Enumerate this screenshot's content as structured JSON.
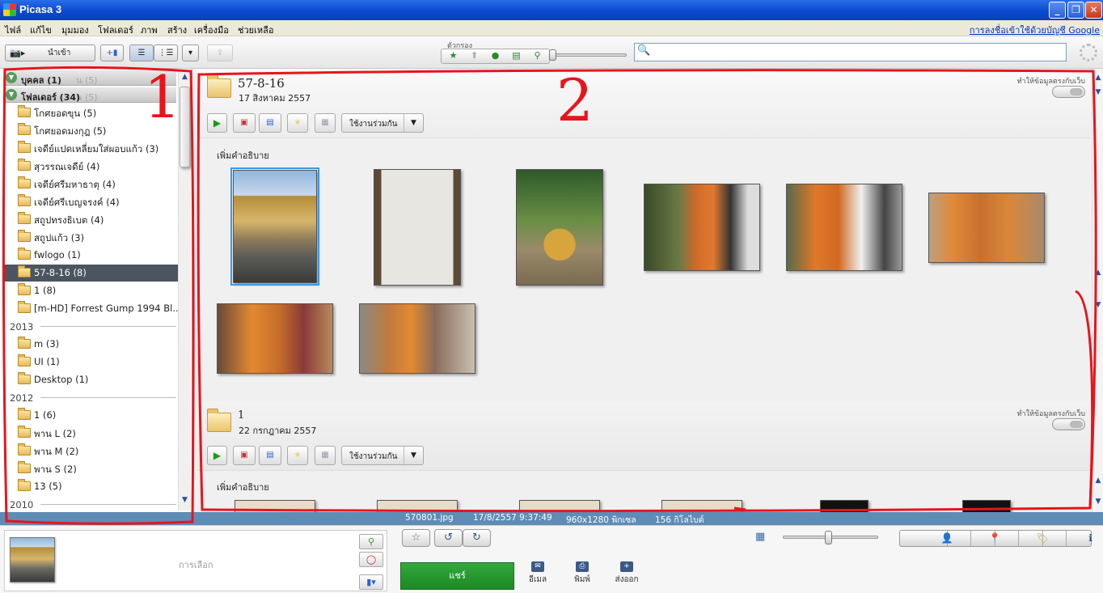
{
  "window": {
    "title": "Picasa 3"
  },
  "menu": {
    "items": [
      "ไฟล์",
      "แก้ไข",
      "มุมมอง",
      "โฟลเดอร์",
      "ภาพ",
      "สร้าง",
      "เครื่องมือ",
      "ช่วยเหลือ"
    ],
    "signin": "การลงชื่อเข้าใช้ด้วยบัญชี Google"
  },
  "toolbar": {
    "import_label": "นำเข้า",
    "filter_label": "ตัวกรอง",
    "search_placeholder": ""
  },
  "library": {
    "groups": [
      {
        "label": "บุคคล (1)",
        "ghost": "น (5)"
      },
      {
        "label": "โฟลเดอร์ (34)",
        "ghost": "น (5)"
      }
    ],
    "rows": [
      {
        "type": "folder",
        "label": "โกศยอดขุน (5)"
      },
      {
        "type": "folder",
        "label": "โกศยอดมงกุฎ (5)"
      },
      {
        "type": "folder",
        "label": "เจดีย์แปดเหลี่ยมใส่ผอบแก้ว (3)"
      },
      {
        "type": "folder",
        "label": "สุวรรณเจดีย์ (4)"
      },
      {
        "type": "folder",
        "label": "เจดีย์ศรีมหาธาตุ (4)"
      },
      {
        "type": "folder",
        "label": "เจดีย์ศรีเบญจรงค์ (4)"
      },
      {
        "type": "folder",
        "label": "สถูปทรงธิเบต (4)"
      },
      {
        "type": "folder",
        "label": "สถูปแก้ว (3)"
      },
      {
        "type": "folder",
        "label": "fwlogo (1)"
      },
      {
        "type": "folder",
        "label": "57-8-16 (8)",
        "selected": true
      },
      {
        "type": "folder",
        "label": "1 (8)"
      },
      {
        "type": "folder",
        "label": "[m-HD] Forrest Gump 1994 Bl..."
      },
      {
        "type": "year",
        "label": "2013"
      },
      {
        "type": "folder",
        "label": "m (3)"
      },
      {
        "type": "folder",
        "label": "UI (1)"
      },
      {
        "type": "folder",
        "label": "Desktop (1)"
      },
      {
        "type": "year",
        "label": "2012"
      },
      {
        "type": "folder",
        "label": "1 (6)"
      },
      {
        "type": "folder",
        "label": "พาน L (2)"
      },
      {
        "type": "folder",
        "label": "พาน M (2)"
      },
      {
        "type": "folder",
        "label": "พาน S (2)"
      },
      {
        "type": "folder",
        "label": "13 (5)"
      },
      {
        "type": "year",
        "label": "2010"
      }
    ]
  },
  "albums": [
    {
      "title": "57-8-16",
      "date": "17 สิงหาคม 2557",
      "sync_label": "ทำให้ข้อมูลตรงกับเว็บ",
      "share_label": "ใช้งานร่วมกัน",
      "caption_label": "เพิ่มคำอธิบาย",
      "photo_count": 8
    },
    {
      "title": "1",
      "date": "22 กรกฎาคม 2557",
      "sync_label": "ทำให้ข้อมูลตรงกับเว็บ",
      "share_label": "ใช้งานร่วมกัน",
      "caption_label": "เพิ่มคำอธิบาย"
    }
  ],
  "status": {
    "filename": "570801.jpg",
    "datetime": "17/8/2557 9:37:49",
    "dimensions": "960x1280 พิกเซล",
    "filesize": "156 กิโลไบต์"
  },
  "tray": {
    "selection_label": "การเลือก",
    "share_label": "แชร์",
    "actions": [
      "อีเมล",
      "พิมพ์",
      "ส่งออก"
    ]
  },
  "annotations": {
    "left_number": "1",
    "main_number": "2",
    "color": "#e8141c"
  },
  "colors": {
    "selected_row": "#4a5560",
    "status_bar": "#5f8cb5",
    "share_button": "#22962c",
    "titlebar": "#0a4ad0"
  }
}
